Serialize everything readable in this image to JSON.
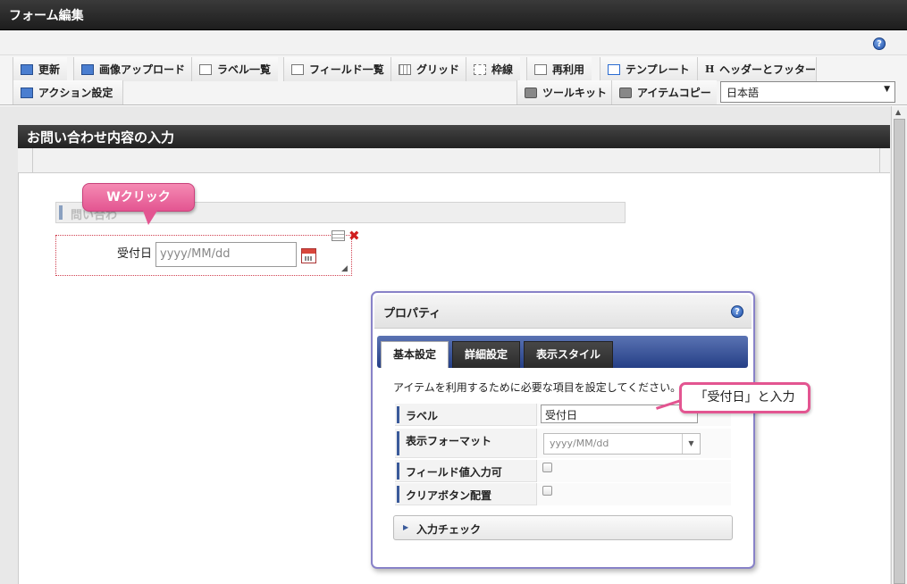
{
  "window": {
    "title": "フォーム編集"
  },
  "toolbar": {
    "row1": [
      {
        "label": "更新",
        "icon": "refresh-icon"
      },
      {
        "label": "画像アップロード",
        "icon": "image-upload-icon"
      },
      {
        "label": "ラベル一覧",
        "icon": "label-list-icon"
      },
      {
        "label": "フィールド一覧",
        "icon": "field-list-icon"
      },
      {
        "label": "グリッド",
        "icon": "grid-icon"
      },
      {
        "label": "枠線",
        "icon": "border-icon"
      },
      {
        "label": "再利用",
        "icon": "reuse-icon"
      },
      {
        "label": "テンプレート",
        "icon": "template-icon"
      },
      {
        "label": "ヘッダーとフッター",
        "icon": "header-footer-icon"
      }
    ],
    "row2": [
      {
        "label": "アクション設定",
        "icon": "action-icon"
      },
      {
        "label": "ツールキット",
        "icon": "toolkit-icon"
      },
      {
        "label": "アイテムコピー",
        "icon": "item-copy-icon"
      }
    ],
    "language": "日本語"
  },
  "form": {
    "title": "お問い合わせ内容の入力",
    "heading_placeholder": "問い合わ",
    "field_label": "受付日",
    "date_placeholder": "yyyy/MM/dd"
  },
  "callouts": {
    "double_click": "Wクリック",
    "enter_label": "「受付日」と入力"
  },
  "properties": {
    "title": "プロパティ",
    "tabs": [
      "基本設定",
      "詳細設定",
      "表示スタイル"
    ],
    "description": "アイテムを利用するために必要な項目を設定してください。",
    "rows": {
      "label": "ラベル",
      "format": "表示フォーマット",
      "field_input": "フィールド値入力可",
      "clear_button": "クリアボタン配置"
    },
    "label_value": "受付日",
    "format_value": "yyyy/MM/dd",
    "accordion": "入力チェック"
  }
}
